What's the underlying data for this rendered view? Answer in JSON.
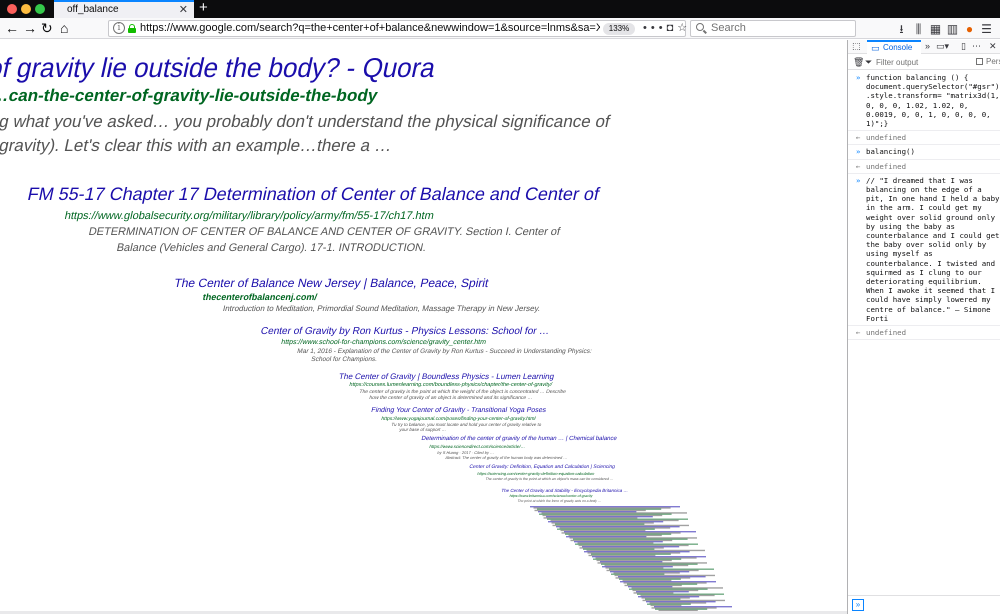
{
  "window": {
    "tab_title": "off_balance"
  },
  "navbar": {
    "url": "https://www.google.com/search?q=the+center+of+balance&newwindow=1&source=lnms&sa=X&ved=0ahUKEwjhuu",
    "zoom": "133%",
    "search_placeholder": "Search"
  },
  "results": [
    {
      "title": "of gravity lie outside the body? - Quora",
      "url": "…can-the-center-of-gravity-lie-outside-the-body",
      "snippet": [
        "ng what you've asked… you probably don't understand the physical significance of",
        "f gravity). Let's clear this with an example…there a …"
      ]
    },
    {
      "title": "FM 55-17 Chapter 17 Determination of Center of Balance and Center of",
      "url": "https://www.globalsecurity.org/military/library/policy/army/fm/55-17/ch17.htm",
      "snippet": [
        "DETERMINATION OF CENTER OF BALANCE AND CENTER OF GRAVITY. Section I. Center of",
        "Balance (Vehicles and General Cargo). 17-1. INTRODUCTION."
      ]
    },
    {
      "title": "The Center of Balance New Jersey | Balance, Peace, Spirit",
      "url": "thecenterofbalancenj.com/",
      "snippet": [
        "Introduction to Meditation, Primordial Sound Meditation, Massage Therapy in New Jersey."
      ]
    },
    {
      "title": "Center of Gravity by Ron Kurtus - Physics Lessons: School for …",
      "url": "https://www.school-for-champions.com/science/gravity_center.htm",
      "snippet": [
        "Mar 1, 2016 - Explanation of the Center of Gravity by Ron Kurtus - Succeed in Understanding Physics:",
        "School for Champions."
      ]
    },
    {
      "title": "The Center of Gravity | Boundless Physics - Lumen Learning",
      "url": "https://courses.lumenlearning.com/boundless-physics/chapter/the-center-of-gravity/",
      "snippet": [
        "The center of gravity is the point at which the weight of the object is concentrated … Describe",
        "how the center of gravity of an object is determined and its significance …"
      ]
    },
    {
      "title": "Finding Your Center of Gravity - Transitional Yoga Poses",
      "url": "https://www.yogajournal.com/poses/finding-your-center-of-gravity.html",
      "snippet": [
        "Tu try to balance, you must locate and hold your center of gravity relative to",
        "your base of support …"
      ]
    },
    {
      "title": "Determination of the center of gravity of the human … | Chemical balance",
      "url": "https://www.sciencedirect.com/science/article/…",
      "snippet": [
        "by S Huang · 2017 · Cited by …",
        "Abstract: The center of gravity of the human body was determined …"
      ]
    },
    {
      "title": "Center of Gravity: Definition, Equation and Calculation | Sciencing",
      "url": "https://sciencing.com/center-gravity-definition-equation-calculation",
      "snippet": [
        "The center of gravity is the point at which an object's mass can be considered …"
      ]
    },
    {
      "title": "The Center of Gravity and Stability - Encyclopedia Britannica …",
      "url": "https://www.britannica.com/science/center-of-gravity",
      "snippet": [
        "The point at which the force of gravity acts on a body …"
      ]
    }
  ],
  "devtools": {
    "tab_label": "Console",
    "filter_placeholder": "Filter output",
    "persist_label": "Pers",
    "input_prompt": "»",
    "entries": [
      {
        "kind": "input",
        "text": "function balancing () {\ndocument.querySelector(\"#gsr\")\n.style.transform= \"matrix3d(1,\n0, 0, 0, 1.02, 1.02, 0,\n0.0019, 0, 0, 1, 0, 0, 0, 0,\n1)\";}"
      },
      {
        "kind": "result",
        "text": "undefined"
      },
      {
        "kind": "input",
        "text": "balancing()"
      },
      {
        "kind": "result",
        "text": "undefined"
      },
      {
        "kind": "input",
        "text": "// \"I dreamed that I was\nbalancing on the edge of a\npit, In one hand I held a baby\nin the arm. I could get my\nweight over solid ground only\nby using the baby as\ncounterbalance and I could get\nthe baby over solid only by\nusing myself as\ncounterbalance. I twisted and\nsquirmed as I clung to our\ndeteriorating equilibrium.\nWhen I awoke it seemed that I\ncould have simply lowered my\ncentre of balance.\" — Simone\nForti"
      },
      {
        "kind": "result",
        "text": "undefined"
      }
    ]
  }
}
